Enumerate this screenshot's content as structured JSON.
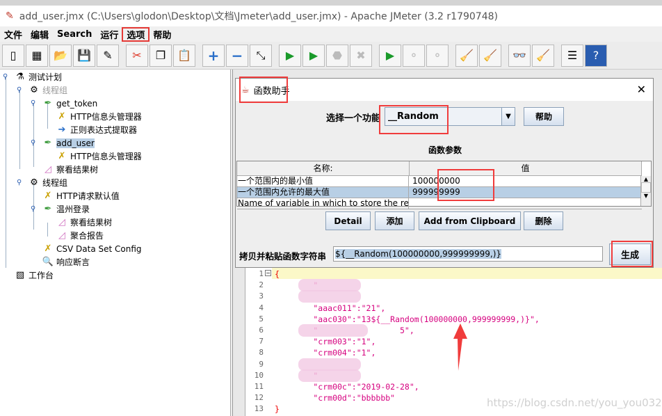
{
  "window": {
    "title": "add_user.jmx (C:\\Users\\glodon\\Desktop\\文档\\Jmeter\\add_user.jmx) - Apache JMeter (3.2 r1790748)"
  },
  "menu": [
    "文件",
    "编辑",
    "Search",
    "运行",
    "选项",
    "帮助"
  ],
  "menu_highlighted": "选项",
  "toolbar_icons": [
    "new-icon",
    "templates-icon",
    "open-icon",
    "save-icon",
    "save-as-icon",
    "cut-icon",
    "copy-icon",
    "paste-icon",
    "expand-icon",
    "collapse-icon",
    "toggle-icon",
    "start-icon",
    "start-no-pause-icon",
    "stop-icon",
    "shutdown-icon",
    "remote-start-icon",
    "remote-stop-icon",
    "remote-shutdown-icon",
    "clear-icon",
    "clear-all-icon",
    "search-icon",
    "reset-search-icon",
    "function-helper-icon",
    "help-icon"
  ],
  "tree": [
    {
      "label": "测试计划",
      "icon": "flask-icon"
    },
    {
      "label": "线程组",
      "icon": "gear-icon",
      "disabled": true
    },
    {
      "label": "get_token",
      "icon": "pipette-icon"
    },
    {
      "label": "HTTP信息头管理器",
      "icon": "tools-icon"
    },
    {
      "label": "正则表达式提取器",
      "icon": "arrow-icon"
    },
    {
      "label": "add_user",
      "icon": "pipette-icon",
      "selected": true
    },
    {
      "label": "HTTP信息头管理器",
      "icon": "tools-icon"
    },
    {
      "label": "察看结果树",
      "icon": "graph-icon"
    },
    {
      "label": "线程组",
      "icon": "gear-icon"
    },
    {
      "label": "HTTP请求默认值",
      "icon": "tools-icon"
    },
    {
      "label": "温州登录",
      "icon": "pipette-icon"
    },
    {
      "label": "察看结果树",
      "icon": "graph-icon"
    },
    {
      "label": "聚合报告",
      "icon": "graph-icon"
    },
    {
      "label": "CSV Data Set Config",
      "icon": "tools-icon"
    },
    {
      "label": "响应断言",
      "icon": "magnifier-icon"
    },
    {
      "label": "工作台",
      "icon": "notepad-icon"
    }
  ],
  "dialog": {
    "title": "函数助手",
    "select_label": "选择一个功能",
    "selected_function": "__Random",
    "help_button": "帮助",
    "params_title": "函数参数",
    "columns": [
      "名称:",
      "值"
    ],
    "rows": [
      {
        "name": "一个范围内的最小值",
        "value": "100000000"
      },
      {
        "name": "一个范围内允许的最大值",
        "value": "999999999",
        "selected": true
      },
      {
        "name": "Name of variable in which to store the result (optio...",
        "value": ""
      }
    ],
    "buttons": [
      "Detail",
      "添加",
      "Add from Clipboard",
      "删除"
    ],
    "string_label": "拷贝并粘贴函数字符串",
    "string_value": "${__Random(100000000,999999999,)}",
    "generate_button": "生成",
    "accent": "#f03c3c"
  },
  "editor": {
    "lines": [
      {
        "n": "1",
        "text": "{"
      },
      {
        "n": "2",
        "text": "        \"",
        "blur": true
      },
      {
        "n": "3",
        "text": "",
        "blur": true
      },
      {
        "n": "4",
        "text": "        \"aaac011\":\"21\","
      },
      {
        "n": "5",
        "text": "        \"aac030\":\"13${__Random(100000000,999999999,)}\","
      },
      {
        "n": "6",
        "text": "        \"                 5\",",
        "blur": true
      },
      {
        "n": "7",
        "text": "        \"crm003\":\"1\","
      },
      {
        "n": "8",
        "text": "        \"crm004\":\"1\","
      },
      {
        "n": "9",
        "text": "",
        "blur": true
      },
      {
        "n": "10",
        "text": "        \"",
        "blur": true
      },
      {
        "n": "11",
        "text": "        \"crm00c\":\"2019-02-28\","
      },
      {
        "n": "12",
        "text": "        \"crm00d\":\"bbbbbb\""
      },
      {
        "n": "13",
        "text": "}"
      }
    ]
  },
  "watermark": "https://blog.csdn.net/you_you0329"
}
